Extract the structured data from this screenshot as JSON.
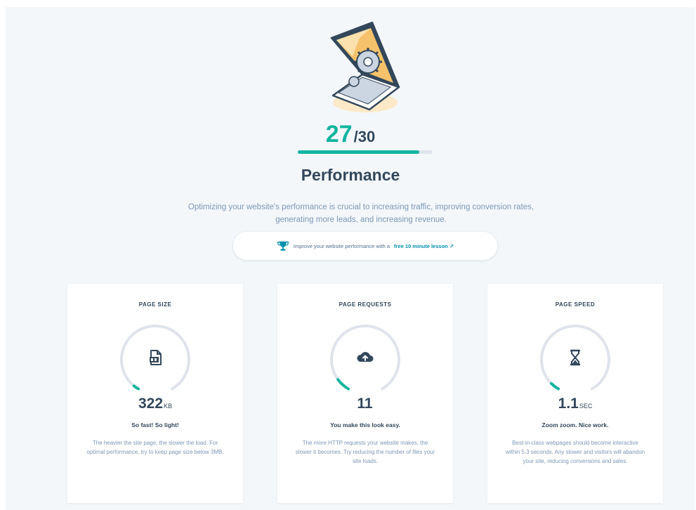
{
  "score": {
    "value": "27",
    "total": "/30",
    "fraction": 0.9,
    "accent_color": "#13b59f"
  },
  "section": {
    "title": "Performance",
    "description": "Optimizing your website's performance is crucial to increasing traffic, improving conversion rates, generating more leads, and increasing revenue."
  },
  "lesson": {
    "icon": "trophy-icon",
    "text": "Improve your website performance with a",
    "link": "free 10 minute lesson"
  },
  "cards": [
    {
      "title": "PAGE SIZE",
      "icon": "file-icon",
      "value": "322",
      "unit": "KB",
      "tagline": "So fast! So light!",
      "description": "The heavier the site page, the slower the load. For optimal performance, try to keep page size below 3MB.",
      "gauge_fraction": 0.03
    },
    {
      "title": "PAGE REQUESTS",
      "icon": "cloud-upload-icon",
      "value": "11",
      "unit": "",
      "tagline": "You make this look easy.",
      "description": "The more HTTP requests your website makes, the slower it becomes. Try reducing the number of files your site loads.",
      "gauge_fraction": 0.08
    },
    {
      "title": "PAGE SPEED",
      "icon": "hourglass-icon",
      "value": "1.1",
      "unit": "SEC",
      "tagline": "Zoom zoom. Nice work.",
      "description": "Best-in-class webpages should become interactive within 5.3 seconds. Any slower and visitors will abandon your site, reducing conversions and sales.",
      "gauge_fraction": 0.05
    }
  ]
}
